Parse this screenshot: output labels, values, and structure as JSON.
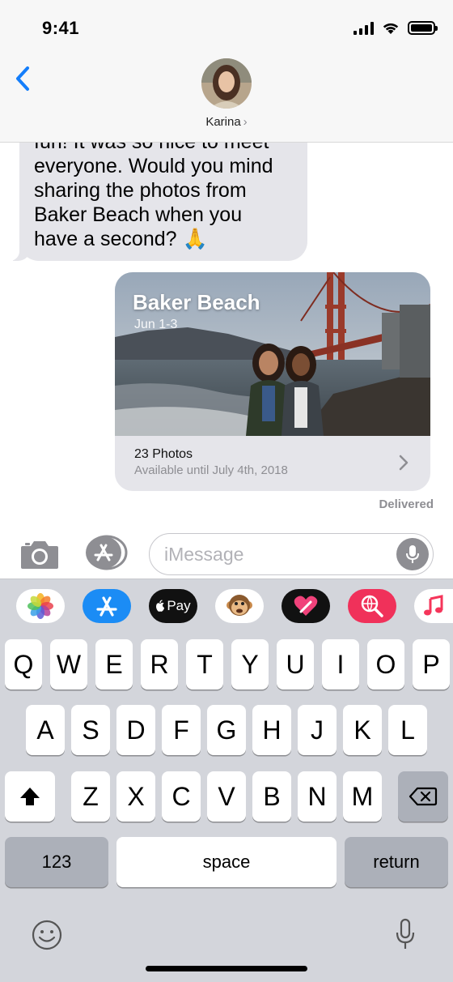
{
  "status_bar": {
    "time": "9:41"
  },
  "header": {
    "contact_name": "Karina",
    "chevron": "›"
  },
  "messages": {
    "incoming": {
      "lines": [
        "fun! It was so nice to meet",
        "everyone. Would you mind",
        "sharing the photos from",
        "Baker Beach when you",
        "have a second? 🙏"
      ]
    },
    "photo_card": {
      "title": "Baker Beach",
      "date": "Jun 1-3",
      "count": "23 Photos",
      "availability": "Available until July 4th, 2018"
    },
    "status": "Delivered"
  },
  "input": {
    "placeholder": "iMessage",
    "value": ""
  },
  "app_strip": {
    "apps": [
      "photos-icon",
      "app-store-icon",
      "apple-pay-icon",
      "animoji-icon",
      "digital-touch-icon",
      "web-search-icon",
      "music-icon"
    ],
    "apple_pay_label": "Pay"
  },
  "keyboard": {
    "row1": [
      "Q",
      "W",
      "E",
      "R",
      "T",
      "Y",
      "U",
      "I",
      "O",
      "P"
    ],
    "row2": [
      "A",
      "S",
      "D",
      "F",
      "G",
      "H",
      "J",
      "K",
      "L"
    ],
    "row3": [
      "Z",
      "X",
      "C",
      "V",
      "B",
      "N",
      "M"
    ],
    "numbers_key": "123",
    "space_key": "space",
    "return_key": "return"
  },
  "colors": {
    "accent": "#147efb",
    "bubble_incoming": "#e5e5ea",
    "keyboard_bg": "#d3d5db"
  }
}
